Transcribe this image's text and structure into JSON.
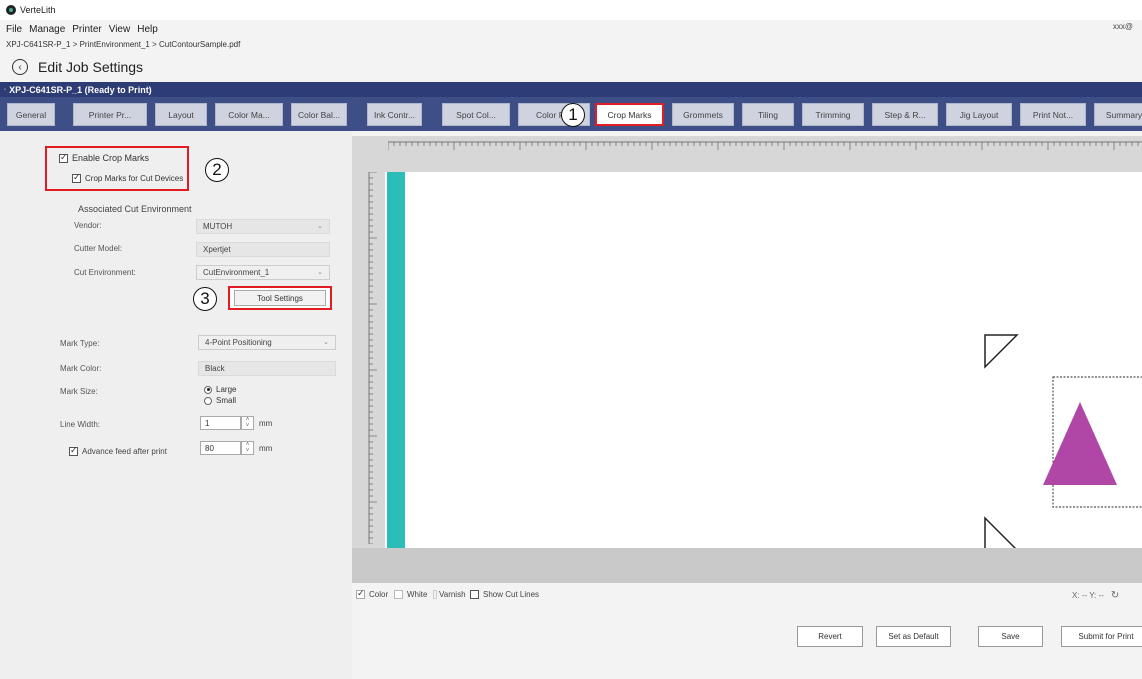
{
  "app": {
    "title": "VerteLith",
    "user": "xxx@"
  },
  "menu": [
    "File",
    "Manage",
    "Printer",
    "View",
    "Help"
  ],
  "breadcrumb": "XPJ-C641SR-P_1 > PrintEnvironment_1 > CutContourSample.pdf",
  "page_title": "Edit Job Settings",
  "printer_status": "XPJ-C641SR-P_1 (Ready to Print)",
  "tabs": [
    {
      "label": "General"
    },
    {
      "label": "Printer Pr..."
    },
    {
      "label": "Layout"
    },
    {
      "label": "Color Ma..."
    },
    {
      "label": "Color Bal..."
    },
    {
      "label": "Ink Contr..."
    },
    {
      "label": "Spot Col..."
    },
    {
      "label": "Color R..."
    },
    {
      "label": "Crop Marks",
      "active": true
    },
    {
      "label": "Grommets"
    },
    {
      "label": "Tiling"
    },
    {
      "label": "Trimming"
    },
    {
      "label": "Step & R..."
    },
    {
      "label": "Jig Layout"
    },
    {
      "label": "Print Not..."
    },
    {
      "label": "Summary"
    }
  ],
  "callouts": [
    "1",
    "2",
    "3"
  ],
  "settings": {
    "enable_crop_marks": "Enable Crop Marks",
    "enable_crop_marks_checked": true,
    "crop_marks_cut_devices": "Crop Marks for Cut Devices",
    "crop_marks_cut_devices_checked": true,
    "associated_cut_env": "Associated Cut Environment",
    "vendor_label": "Vendor:",
    "vendor_value": "MUTOH",
    "cutter_model_label": "Cutter Model:",
    "cutter_model_value": "Xpertjet",
    "cut_env_label": "Cut Environment:",
    "cut_env_value": "CutEnvironment_1",
    "tool_settings": "Tool Settings",
    "mark_type_label": "Mark Type:",
    "mark_type_value": "4-Point Positioning",
    "mark_color_label": "Mark Color:",
    "mark_color_value": "Black",
    "mark_size_label": "Mark Size:",
    "mark_size_large": "Large",
    "mark_size_small": "Small",
    "line_width_label": "Line Width:",
    "line_width_value": "1",
    "line_width_unit": "mm",
    "advance_feed_label": "Advance feed after print",
    "advance_feed_checked": true,
    "advance_feed_value": "80",
    "advance_feed_unit": "mm"
  },
  "preview": {
    "options": {
      "color": "Color",
      "color_checked": true,
      "white": "White",
      "white_checked": false,
      "varnish": "Varnish",
      "varnish_checked": false,
      "show_cut_lines": "Show Cut Lines",
      "show_cut_lines_checked": false
    },
    "coords": "X: --  Y: --",
    "colors": {
      "teal": "#2bbdb8",
      "triangle": "#b047a6"
    }
  },
  "actions": {
    "revert": "Revert",
    "set_default": "Set as Default",
    "save": "Save",
    "submit": "Submit for Print"
  }
}
